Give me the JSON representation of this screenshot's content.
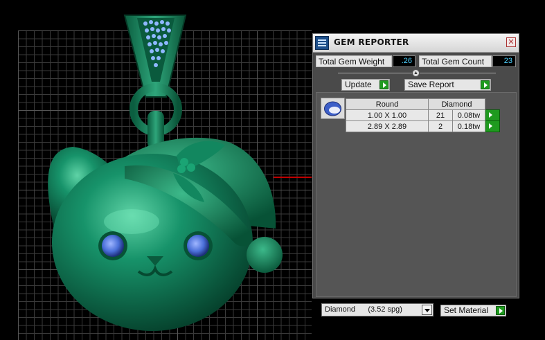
{
  "panel": {
    "title": "GEM REPORTER",
    "close_symbol": "✕",
    "total_weight_label": "Total Gem Weight",
    "total_weight_value": ".26",
    "total_count_label": "Total Gem Count",
    "total_count_value": "23",
    "update_label": "Update",
    "save_report_label": "Save Report",
    "table": {
      "headers": [
        "Round",
        "Diamond"
      ],
      "rows": [
        {
          "size": "1.00 X 1.00",
          "count": "21",
          "weight": "0.08tw"
        },
        {
          "size": "2.89 X 2.89",
          "count": "2",
          "weight": "0.18tw"
        }
      ]
    },
    "material_value": "Diamond      (3.52 spg)",
    "set_material_label": "Set Material"
  },
  "colors": {
    "model_green": "#0f7a55",
    "gem_blue": "#4a6fd8",
    "axis_red": "#c00000",
    "value_cyan": "#4fd2ff",
    "go_green": "#1f9a1f"
  }
}
